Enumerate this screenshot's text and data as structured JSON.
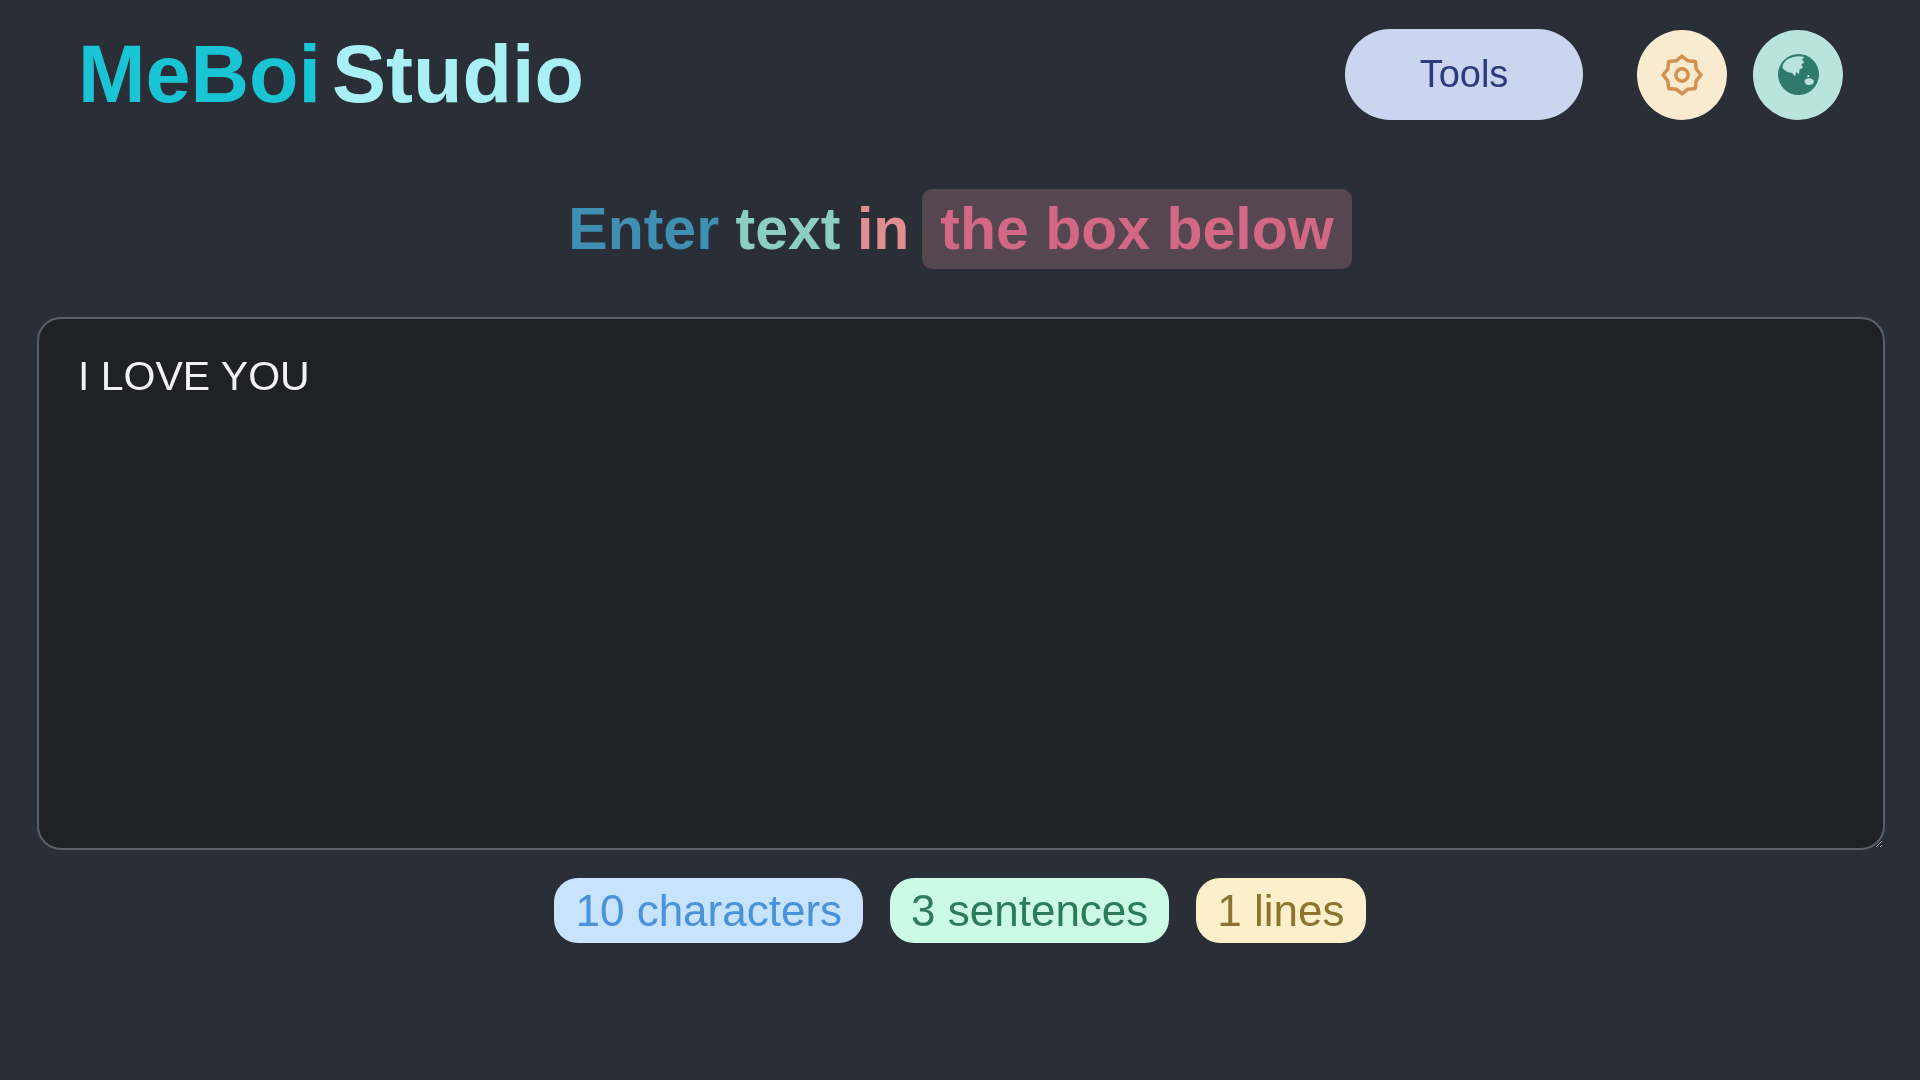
{
  "header": {
    "logo": [
      {
        "text": "MeBoi",
        "color": "#19c4d4"
      },
      {
        "text": "Studio",
        "color": "#a8eff6"
      }
    ],
    "tools_button": {
      "label": "Tools"
    }
  },
  "heading": {
    "parts": [
      {
        "text": "Enter",
        "color": "#3f8fb3"
      },
      {
        "text": "text",
        "color": "#8ccfc1"
      },
      {
        "text": "in",
        "color": "#df8f90"
      }
    ],
    "highlight": {
      "text": "the box below",
      "color": "#d36886"
    }
  },
  "editor": {
    "value": "I LOVE YOU"
  },
  "stats": [
    {
      "text": "10 characters",
      "color": "#4a92dc"
    },
    {
      "text": "3 sentences",
      "color": "#2e7b57"
    },
    {
      "text": "1 lines",
      "color": "#8c7430"
    }
  ]
}
